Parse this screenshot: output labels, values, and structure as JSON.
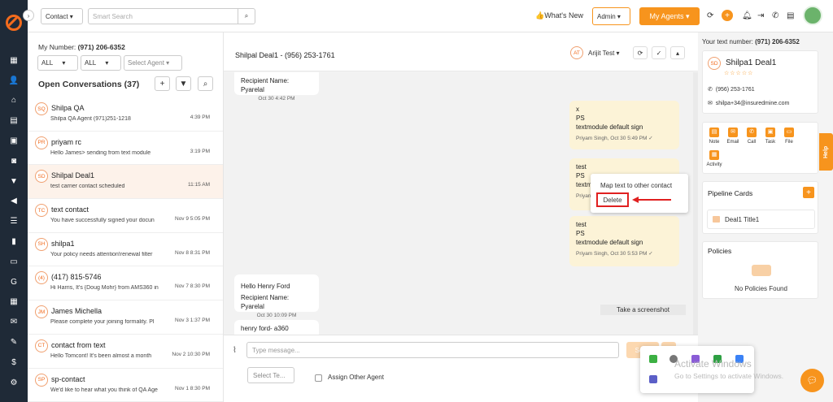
{
  "topbar": {
    "contact_select": "Contact",
    "search_placeholder": "Smart Search",
    "whats_new": "What's New",
    "admin_select": "Admin",
    "my_agents": "My Agents",
    "accent_color": "#f7941d"
  },
  "left": {
    "my_number_label": "My Number:",
    "my_number": "(971) 206-6352",
    "filters": [
      "ALL",
      "ALL"
    ],
    "select_agent": "Select Agent",
    "open_conversations": "Open Conversations (37)",
    "conversations": [
      {
        "initials": "SQ",
        "name": "Shilpa QA",
        "preview": "Shilpa QA Agent (971)251-1218",
        "time": "4:39 PM"
      },
      {
        "initials": "PR",
        "name": "priyam rc",
        "preview": "Hello James> sending from text module",
        "time": "3:19 PM"
      },
      {
        "initials": "SD",
        "name": "Shilpal Deal1",
        "preview": "test carrier contact scheduled",
        "time": "11:15 AM"
      },
      {
        "initials": "TC",
        "name": "text contact",
        "preview": "You have successfully signed your docun",
        "time": "Nov 9 5:05 PM"
      },
      {
        "initials": "SH",
        "name": "shilpa1",
        "preview": "Your policy needs attention!renewal filter",
        "time": "Nov 8 8:31 PM"
      },
      {
        "initials": "(4)",
        "name": "(417) 815-5746",
        "preview": "Hi Harris, It's {Doug Mohr} from AMS360 in",
        "time": "Nov 7 8:30 PM"
      },
      {
        "initials": "JM",
        "name": "James Michella",
        "preview": "Please complete your joining formality. Pl",
        "time": "Nov 3 1:37 PM"
      },
      {
        "initials": "CT",
        "name": "contact from text",
        "preview": "Hello Tomcont! It's been almost a month",
        "time": "Nov 2 10:30 PM"
      },
      {
        "initials": "SP",
        "name": "sp-contact",
        "preview": "We'd like to hear what you think of QA Age",
        "time": "Nov 1 8:30 PM"
      }
    ]
  },
  "chat": {
    "title": "Shilpal Deal1 - (956) 253-1761",
    "agent_initials": "AT",
    "agent_name": "Arijit Test",
    "messages": {
      "m1_line1": "Recipient Name: Pyarelal",
      "m1_meta": "Oct 30 4:42 PM",
      "m2_line1": "x",
      "m2_line2": "PS",
      "m2_line3": "textmodule default sign",
      "m2_meta": "Priyam Singh,  Oct 30 5:49 PM ✓",
      "m3_line1": "test",
      "m3_line2": "PS",
      "m3_line3": "textm",
      "m3_meta": "Priyan",
      "m4_line1": "test",
      "m4_line2": "PS",
      "m4_line3": "textmodule default sign",
      "m4_meta": "Priyam Singh,  Oct 30 5:53 PM ✓",
      "m5_line1": "Hello Henry Ford",
      "m5_line2": "Recipient Name: Pyarelal",
      "m5_meta": "Oct 30 10:09 PM",
      "m6_line1": "henry ford- a360"
    },
    "context_menu": {
      "map": "Map text to other contact",
      "delete": "Delete"
    },
    "screenshot_tip": "Take a screenshot",
    "input_placeholder": "Type message...",
    "send": "Send",
    "template_select": "Select Te...",
    "assign_other": "Assign Other Agent"
  },
  "right": {
    "text_number_label": "Your text number:",
    "text_number": "(971) 206-6352",
    "contact_initials": "SD",
    "contact_name": "Shilpa1 Deal1",
    "stars": "☆☆☆☆☆",
    "phone": "(956) 253-1761",
    "email": "shilpa+34@insuredmine.com",
    "actions": [
      "Note",
      "Email",
      "Call",
      "Task",
      "File",
      "Activity"
    ],
    "pipeline_title": "Pipeline Cards",
    "pipeline_item": "Deal1 Title1",
    "policies_title": "Policies",
    "no_policies": "No Policies Found",
    "help": "Help"
  },
  "overlay": {
    "activate_title": "Activate Windows",
    "activate_sub": "Go to Settings to activate Windows."
  }
}
